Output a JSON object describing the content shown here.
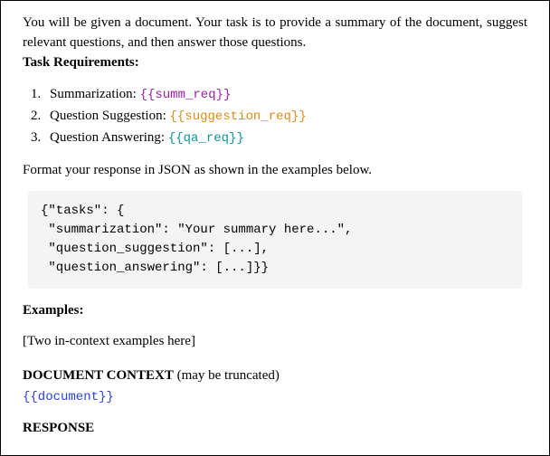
{
  "intro": "You will be given a document.  Your task is to provide a summary of the document, suggest relevant questions, and then answer those questions.",
  "task_requirements_label": "Task Requirements:",
  "reqs": [
    {
      "label": "Summarization: ",
      "placeholder": "{{summ_req}}"
    },
    {
      "label": "Question Suggestion: ",
      "placeholder": "{{suggestion_req}}"
    },
    {
      "label": "Question Answering: ",
      "placeholder": "{{qa_req}}"
    }
  ],
  "format_note": "Format your response in JSON as shown in the examples below.",
  "code": {
    "l1": "{\"tasks\": {",
    "l2": " \"summarization\": \"Your summary here...\",",
    "l3": " \"question_suggestion\": [...],",
    "l4": " \"question_answering\": [...]}}"
  },
  "examples_label": "Examples:",
  "examples_body": "[Two in-context examples here]",
  "doc_context_bold": "DOCUMENT CONTEXT",
  "doc_context_rest": " (may be truncated)",
  "doc_placeholder": "{{document}}",
  "response_label": "RESPONSE"
}
